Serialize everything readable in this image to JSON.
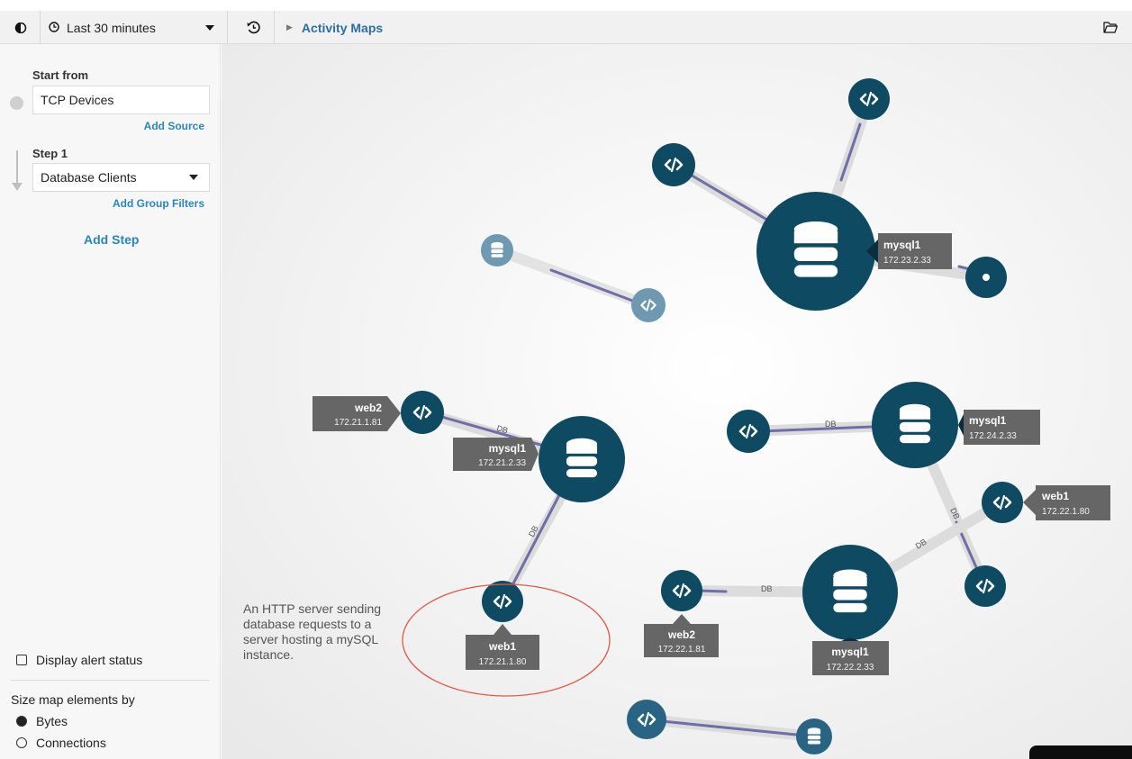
{
  "toolbar": {
    "time_range": "Last 30 minutes",
    "breadcrumb": "Activity Maps",
    "icons": [
      "toggle-icon",
      "clock-icon",
      "caret-down-icon",
      "history-icon",
      "breadcrumb-arrow-icon",
      "folder-icon"
    ]
  },
  "sidebar": {
    "start_from_label": "Start from",
    "source_value": "TCP Devices",
    "add_source": "Add Source",
    "step_label": "Step 1",
    "step_value": "Database Clients",
    "add_group_filters": "Add Group Filters",
    "add_step": "Add Step",
    "display_alert_status": "Display alert status",
    "size_by_label": "Size map elements by",
    "size_options": [
      {
        "label": "Bytes",
        "selected": true
      },
      {
        "label": "Connections",
        "selected": false
      }
    ]
  },
  "map": {
    "annotation": "An HTTP server sending database requests to a server hosting a mySQL instance.",
    "edge_label": "DB",
    "nodes": {
      "mysql1_a": {
        "name": "mysql1",
        "ip": "172.23.2.33"
      },
      "mysql1_b": {
        "name": "mysql1",
        "ip": "172.21.2.33"
      },
      "web2_a": {
        "name": "web2",
        "ip": "172.21.1.81"
      },
      "web1_a": {
        "name": "web1",
        "ip": "172.21.1.80"
      },
      "mysql1_c": {
        "name": "mysql1",
        "ip": "172.24.2.33"
      },
      "web1_b": {
        "name": "web1",
        "ip": "172.22.1.80"
      },
      "web2_b": {
        "name": "web2",
        "ip": "172.22.1.81"
      },
      "mysql1_d": {
        "name": "mysql1",
        "ip": "172.22.2.33"
      }
    },
    "colors": {
      "node": "#0f4a63",
      "node_faded": "#6b96ad",
      "edge": "#6d6ba6",
      "edge_halo": "#d9d9d9",
      "label_bg": "#666666",
      "highlight_ring": "#e05a45"
    }
  }
}
